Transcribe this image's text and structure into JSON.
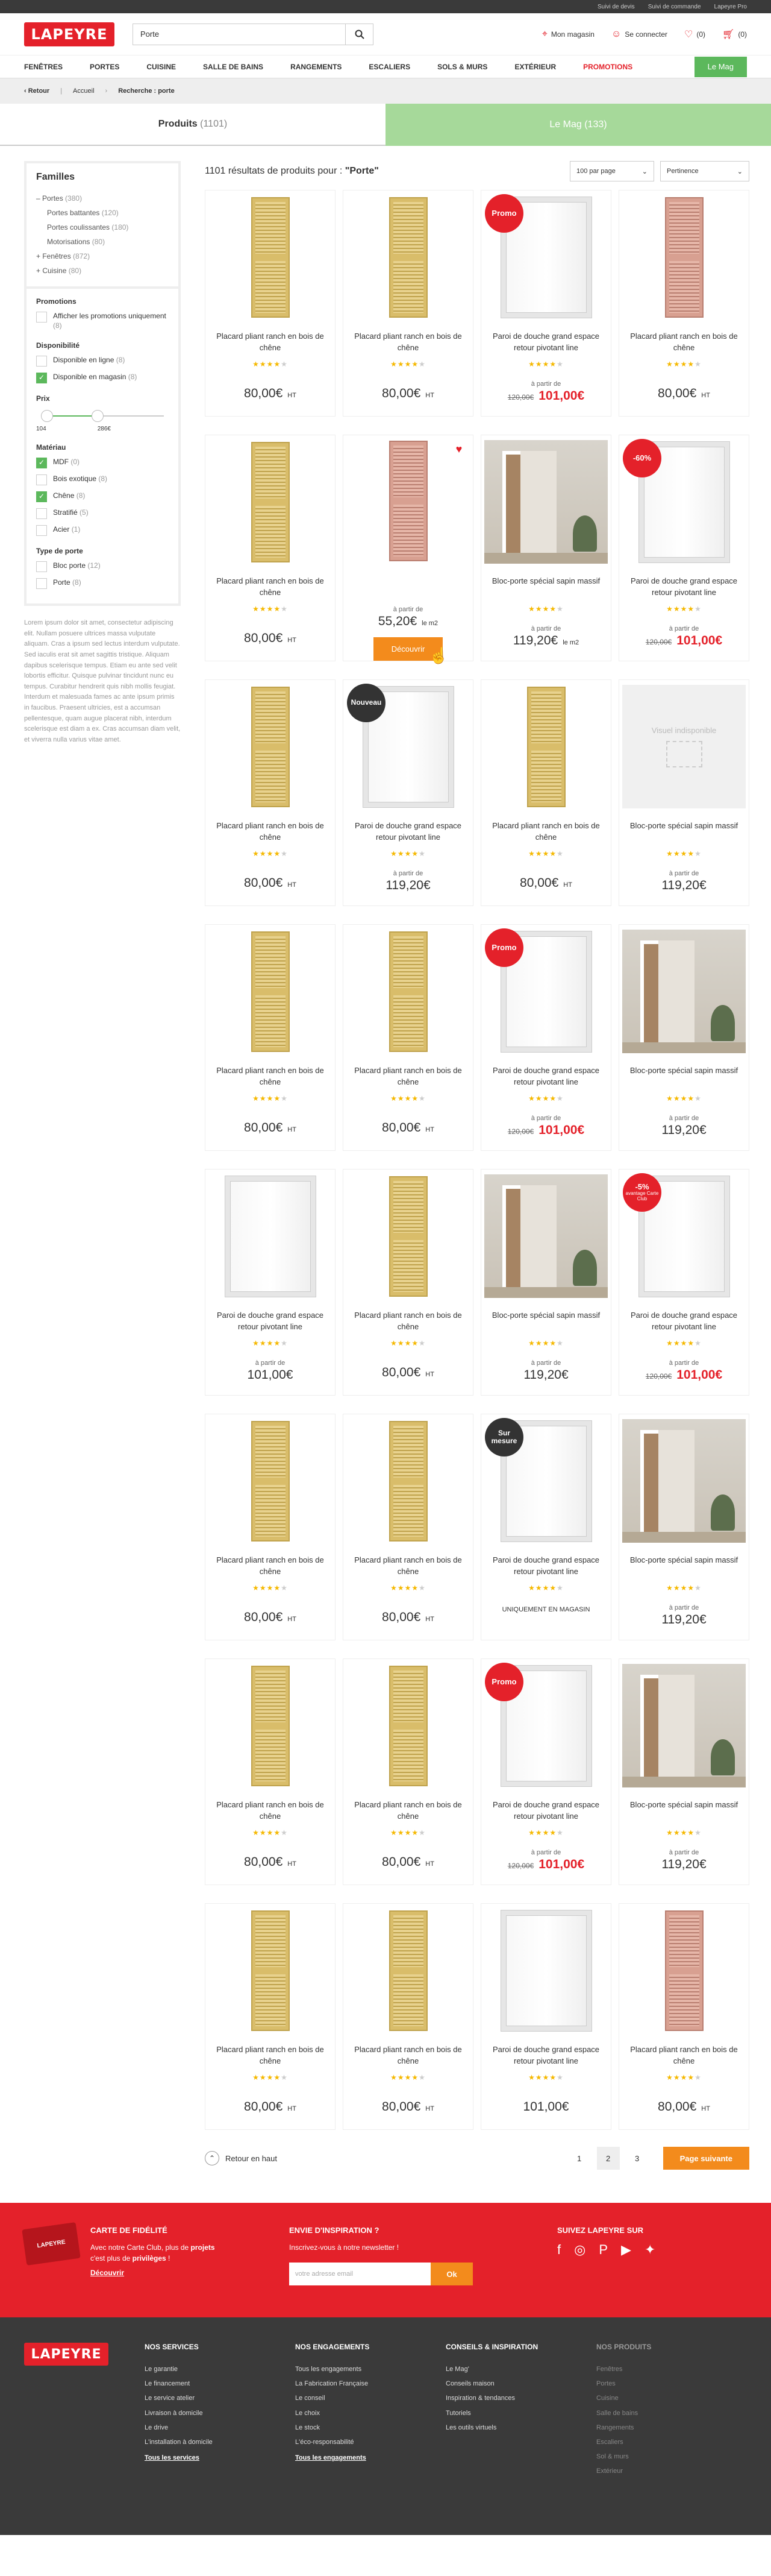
{
  "utilbar": [
    "Suivi de devis",
    "Suivi de commande",
    "Lapeyre Pro"
  ],
  "header": {
    "logo": "LAPEYRE",
    "search_value": "Porte",
    "store": "Mon magasin",
    "login": "Se connecter",
    "fav_count": "(0)",
    "cart_count": "(0)"
  },
  "nav": {
    "items": [
      "FENÊTRES",
      "PORTES",
      "CUISINE",
      "SALLE DE BAINS",
      "RANGEMENTS",
      "ESCALIERS",
      "SOLS & MURS",
      "EXTÉRIEUR"
    ],
    "promo": "PROMOTIONS",
    "mag": "Le Mag"
  },
  "breadcrumb": {
    "back": "Retour",
    "home": "Accueil",
    "current": "Recherche : porte"
  },
  "tabs": {
    "products": "Produits",
    "products_count": "(1101)",
    "mag": "Le Mag (133)"
  },
  "sidebar": {
    "families_title": "Familles",
    "families": [
      {
        "label": "Portes",
        "count": "(380)",
        "prefix": "–"
      },
      {
        "label": "Portes battantes",
        "count": "(120)",
        "sub": true
      },
      {
        "label": "Portes coulissantes",
        "count": "(180)",
        "sub": true
      },
      {
        "label": "Motorisations",
        "count": "(80)",
        "sub": true
      },
      {
        "label": "Fenêtres",
        "count": "(872)",
        "prefix": "+"
      },
      {
        "label": "Cuisine",
        "count": "(80)",
        "prefix": "+"
      }
    ],
    "promotions_title": "Promotions",
    "promotions": [
      {
        "label": "Afficher les promotions uniquement",
        "count": "(8)",
        "on": false
      }
    ],
    "dispo_title": "Disponibilité",
    "dispo": [
      {
        "label": "Disponible en ligne",
        "count": "(8)",
        "on": false
      },
      {
        "label": "Disponible en magasin",
        "count": "(8)",
        "on": true
      }
    ],
    "prix_title": "Prix",
    "prix_min": "104",
    "prix_max": "286€",
    "materiau_title": "Matériau",
    "materiau": [
      {
        "label": "MDF",
        "count": "(0)",
        "on": true
      },
      {
        "label": "Bois exotique",
        "count": "(8)",
        "on": false
      },
      {
        "label": "Chêne",
        "count": "(8)",
        "on": true
      },
      {
        "label": "Stratifié",
        "count": "(5)",
        "on": false
      },
      {
        "label": "Acier",
        "count": "(1)",
        "on": false
      }
    ],
    "type_title": "Type de porte",
    "types": [
      {
        "label": "Bloc porte",
        "count": "(12)",
        "on": false
      },
      {
        "label": "Porte",
        "count": "(8)",
        "on": false
      }
    ],
    "lorem": "Lorem ipsum dolor sit amet, consectetur adipiscing elit. Nullam posuere ultrices massa vulputate aliquam. Cras a ipsum sed lectus interdum vulputate. Sed iaculis erat sit amet sagittis tristique. Aliquam dapibus scelerisque tempus. Etiam eu ante sed velit lobortis efficitur. Quisque pulvinar tincidunt nunc eu tempus. Curabitur hendrerit quis nibh mollis feugiat. Interdum et malesuada fames ac ante ipsum primis in faucibus. Praesent ultricies, est a accumsan pellentesque, quam augue placerat nibh, interdum scelerisque est diam a ex. Cras accumsan diam velit, et viverra nulla varius vitae amet."
  },
  "results": {
    "count_text": "1101 résultats de produits pour : ",
    "query": "\"Porte\"",
    "per_page": "100 par page",
    "sort": "Pertinence"
  },
  "labels": {
    "apartir": "à partir de",
    "placard": "Placard pliant ranch en bois de chêne",
    "paroi": "Paroi de douche grand espace retour pivotant line",
    "bloc": "Bloc-porte spécial sapin massif",
    "ht": "HT",
    "lem2": "le m2",
    "discover": "Découvrir",
    "novisual": "Visuel indisponible",
    "unique": "UNIQUEMENT EN MAGASIN"
  },
  "products": [
    {
      "img": "door",
      "name": "placard",
      "stars": 4,
      "price": "80,00€",
      "ht": true
    },
    {
      "img": "door",
      "name": "placard",
      "stars": 4,
      "price": "80,00€",
      "ht": true
    },
    {
      "img": "shower",
      "name": "paroi",
      "stars": 4,
      "apartir": true,
      "old": "120,00€",
      "price": "101,00€",
      "promo": true,
      "badge": "Promo"
    },
    {
      "img": "doorpink",
      "name": "placard",
      "stars": 4,
      "price": "80,00€",
      "ht": true
    },
    {
      "img": "door",
      "name": "placard",
      "stars": 4,
      "price": "80,00€",
      "ht": true
    },
    {
      "img": "doorpink",
      "hover": true,
      "fav": true,
      "apartir": true,
      "price": "55,20€",
      "m2": true
    },
    {
      "img": "room",
      "name": "bloc",
      "stars": 4,
      "apartir": true,
      "price": "119,20€",
      "m2": true
    },
    {
      "img": "shower",
      "name": "paroi",
      "stars": 4,
      "apartir": true,
      "old": "120,00€",
      "price": "101,00€",
      "promo": true,
      "badge": "-60%"
    },
    {
      "img": "door",
      "name": "placard",
      "stars": 4,
      "price": "80,00€",
      "ht": true
    },
    {
      "img": "shower",
      "name": "paroi",
      "stars": 4,
      "apartir": true,
      "price": "119,20€",
      "badge": "Nouveau",
      "dark": true
    },
    {
      "img": "door",
      "name": "placard",
      "stars": 4,
      "price": "80,00€",
      "ht": true
    },
    {
      "img": "novisual",
      "name": "bloc",
      "stars": 4,
      "apartir": true,
      "price": "119,20€"
    },
    {
      "img": "door",
      "name": "placard",
      "stars": 4,
      "price": "80,00€",
      "ht": true
    },
    {
      "img": "door",
      "name": "placard",
      "stars": 4,
      "price": "80,00€",
      "ht": true
    },
    {
      "img": "shower",
      "name": "paroi",
      "stars": 4,
      "apartir": true,
      "old": "120,00€",
      "price": "101,00€",
      "promo": true,
      "badge": "Promo"
    },
    {
      "img": "room",
      "name": "bloc",
      "stars": 4,
      "apartir": true,
      "price": "119,20€"
    },
    {
      "img": "shower",
      "name": "paroi",
      "stars": 4,
      "apartir": true,
      "price": "101,00€"
    },
    {
      "img": "door",
      "name": "placard",
      "stars": 4,
      "price": "80,00€",
      "ht": true
    },
    {
      "img": "room",
      "name": "bloc",
      "stars": 4,
      "apartir": true,
      "price": "119,20€"
    },
    {
      "img": "shower",
      "name": "paroi",
      "stars": 4,
      "apartir": true,
      "old": "120,00€",
      "price": "101,00€",
      "promo": true,
      "badge": "-5%",
      "badgeSub": "avantage Carte Club"
    },
    {
      "img": "door",
      "name": "placard",
      "stars": 4,
      "price": "80,00€",
      "ht": true
    },
    {
      "img": "door",
      "name": "placard",
      "stars": 4,
      "price": "80,00€",
      "ht": true
    },
    {
      "img": "shower",
      "name": "paroi",
      "stars": 4,
      "unique": true,
      "badge": "Sur mesure",
      "dark": true
    },
    {
      "img": "room",
      "name": "bloc",
      "stars": 4,
      "apartir": true,
      "price": "119,20€"
    },
    {
      "img": "door",
      "name": "placard",
      "stars": 4,
      "price": "80,00€",
      "ht": true
    },
    {
      "img": "door",
      "name": "placard",
      "stars": 4,
      "price": "80,00€",
      "ht": true
    },
    {
      "img": "shower",
      "name": "paroi",
      "stars": 4,
      "apartir": true,
      "old": "120,00€",
      "price": "101,00€",
      "promo": true,
      "badge": "Promo"
    },
    {
      "img": "room",
      "name": "bloc",
      "stars": 4,
      "apartir": true,
      "price": "119,20€"
    },
    {
      "img": "door",
      "name": "placard",
      "stars": 4,
      "price": "80,00€",
      "ht": true
    },
    {
      "img": "door",
      "name": "placard",
      "stars": 4,
      "price": "80,00€",
      "ht": true
    },
    {
      "img": "shower",
      "name": "paroi",
      "stars": 4,
      "price": "101,00€"
    },
    {
      "img": "doorpink",
      "name": "placard",
      "stars": 4,
      "price": "80,00€",
      "ht": true
    }
  ],
  "pager": {
    "top": "Retour en haut",
    "pages": [
      "1",
      "2",
      "3"
    ],
    "active": "2",
    "next": "Page suivante"
  },
  "redband": {
    "fid_title": "CARTE DE FIDÉLITÉ",
    "fid_card": "LAPEYRE",
    "fid_text_1": "Avec notre Carte Club, plus de ",
    "fid_text_b1": "projets",
    "fid_text_2": " c'est plus de ",
    "fid_text_b2": "privilèges",
    "fid_text_3": " !",
    "fid_link": "Découvrir",
    "insp_title": "ENVIE D'INSPIRATION ?",
    "insp_text": "Inscrivez-vous à notre newsletter !",
    "nl_placeholder": "votre adresse email",
    "nl_ok": "Ok",
    "soc_title": "SUIVEZ LAPEYRE SUR",
    "socials": [
      "f",
      "◎",
      "P",
      "▶",
      "✦"
    ]
  },
  "footer": {
    "logo": "LAPEYRE",
    "cols": [
      {
        "title": "NOS SERVICES",
        "items": [
          "Le garantie",
          "Le financement",
          "Le service atelier",
          "Livraison à domicile",
          "Le drive",
          "L'installation à domicile"
        ],
        "all": "Tous les services"
      },
      {
        "title": "NOS ENGAGEMENTS",
        "items": [
          "Tous les engagements",
          "La Fabrication Française",
          "Le conseil",
          "Le choix",
          "Le stock",
          "L'éco-responsabilité"
        ],
        "all": "Tous les engagements"
      },
      {
        "title": "CONSEILS & INSPIRATION",
        "items": [
          "Le Mag'",
          "Conseils maison",
          "Inspiration & tendances",
          "Tutoriels",
          "Les outils virtuels"
        ]
      },
      {
        "title": "NOS PRODUITS",
        "items": [
          "Fenêtres",
          "Portes",
          "Cuisine",
          "Salle de bains",
          "Rangements",
          "Escaliers",
          "Sol & murs",
          "Extérieur"
        ],
        "gray": true
      }
    ]
  },
  "colors": {
    "brand": "#e4212a",
    "accent": "#f38b1c",
    "green": "#5cb85c",
    "dark": "#3a3a3a"
  }
}
